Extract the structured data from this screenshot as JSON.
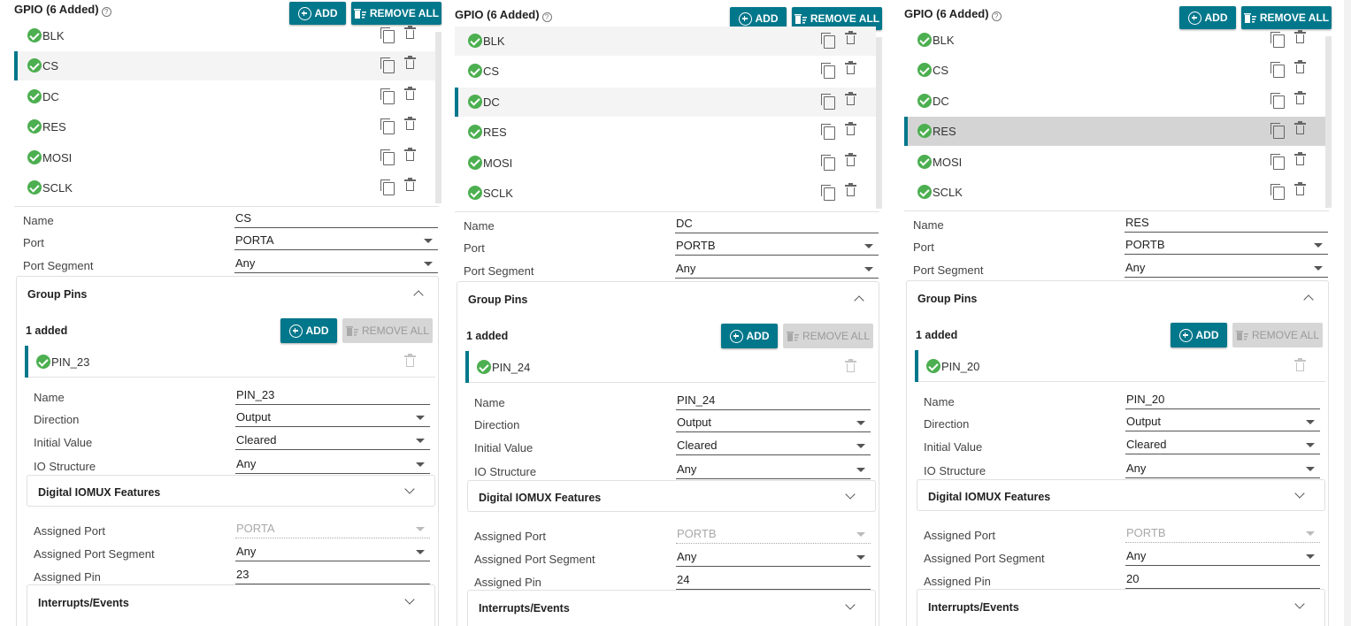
{
  "panels": [
    {
      "header": {
        "title": "GPIO (6 Added)",
        "add_label": "ADD",
        "remove_all_label": "REMOVE ALL"
      },
      "gpio_items": [
        "BLK",
        "CS",
        "DC",
        "RES",
        "MOSI",
        "SCLK"
      ],
      "selected_gpio": "CS",
      "props": {
        "name_label": "Name",
        "name_value": "CS",
        "port_label": "Port",
        "port_value": "PORTA",
        "port_segment_label": "Port Segment",
        "port_segment_value": "Any"
      },
      "group_pins": {
        "title": "Group Pins",
        "added": "1 added",
        "add_label": "ADD",
        "remove_all_label": "REMOVE ALL",
        "pin": "PIN_23",
        "name_label": "Name",
        "name_value": "PIN_23",
        "direction_label": "Direction",
        "direction_value": "Output",
        "initial_value_label": "Initial Value",
        "initial_value_value": "Cleared",
        "io_structure_label": "IO Structure",
        "io_structure_value": "Any",
        "digital_iomux_title": "Digital IOMUX Features",
        "assigned_port_label": "Assigned Port",
        "assigned_port_value": "PORTA",
        "assigned_port_segment_label": "Assigned Port Segment",
        "assigned_port_segment_value": "Any",
        "assigned_pin_label": "Assigned Pin",
        "assigned_pin_value": "23",
        "interrupts_title": "Interrupts/Events"
      }
    },
    {
      "header": {
        "title": "GPIO (6 Added)",
        "add_label": "ADD",
        "remove_all_label": "REMOVE ALL"
      },
      "gpio_items": [
        "BLK",
        "CS",
        "DC",
        "RES",
        "MOSI",
        "SCLK"
      ],
      "selected_gpio": "DC",
      "props": {
        "name_label": "Name",
        "name_value": "DC",
        "port_label": "Port",
        "port_value": "PORTB",
        "port_segment_label": "Port Segment",
        "port_segment_value": "Any"
      },
      "group_pins": {
        "title": "Group Pins",
        "added": "1 added",
        "add_label": "ADD",
        "remove_all_label": "REMOVE ALL",
        "pin": "PIN_24",
        "name_label": "Name",
        "name_value": "PIN_24",
        "direction_label": "Direction",
        "direction_value": "Output",
        "initial_value_label": "Initial Value",
        "initial_value_value": "Cleared",
        "io_structure_label": "IO Structure",
        "io_structure_value": "Any",
        "digital_iomux_title": "Digital IOMUX Features",
        "assigned_port_label": "Assigned Port",
        "assigned_port_value": "PORTB",
        "assigned_port_segment_label": "Assigned Port Segment",
        "assigned_port_segment_value": "Any",
        "assigned_pin_label": "Assigned Pin",
        "assigned_pin_value": "24",
        "interrupts_title": "Interrupts/Events"
      }
    },
    {
      "header": {
        "title": "GPIO (6 Added)",
        "add_label": "ADD",
        "remove_all_label": "REMOVE ALL"
      },
      "gpio_items": [
        "BLK",
        "CS",
        "DC",
        "RES",
        "MOSI",
        "SCLK"
      ],
      "selected_gpio": "RES",
      "props": {
        "name_label": "Name",
        "name_value": "RES",
        "port_label": "Port",
        "port_value": "PORTB",
        "port_segment_label": "Port Segment",
        "port_segment_value": "Any"
      },
      "group_pins": {
        "title": "Group Pins",
        "added": "1 added",
        "add_label": "ADD",
        "remove_all_label": "REMOVE ALL",
        "pin": "PIN_20",
        "name_label": "Name",
        "name_value": "PIN_20",
        "direction_label": "Direction",
        "direction_value": "Output",
        "initial_value_label": "Initial Value",
        "initial_value_value": "Cleared",
        "io_structure_label": "IO Structure",
        "io_structure_value": "Any",
        "digital_iomux_title": "Digital IOMUX Features",
        "assigned_port_label": "Assigned Port",
        "assigned_port_value": "PORTB",
        "assigned_port_segment_label": "Assigned Port Segment",
        "assigned_port_segment_value": "Any",
        "assigned_pin_label": "Assigned Pin",
        "assigned_pin_value": "20",
        "interrupts_title": "Interrupts/Events"
      }
    }
  ],
  "colors": {
    "accent": "#00778b",
    "check": "#4caf50",
    "disabled_button": "#d6d6d6"
  }
}
